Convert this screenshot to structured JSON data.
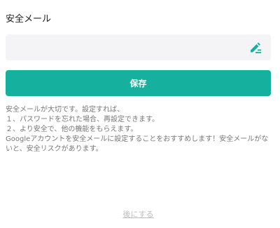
{
  "section": {
    "title": "安全メール"
  },
  "email_field": {
    "value": "",
    "placeholder": "",
    "edit_icon": "pencil-edit-icon"
  },
  "save_button": {
    "label": "保存"
  },
  "description": {
    "lines": [
      "安全メールが大切です。設定すれば、",
      "１、パスワードを忘れた場合、再設定できます。",
      "２、より安全で、他の機能をもらえます。",
      "Googleアカウントを安全メールに設定することをおすすめします！安全メールがないと、安全リスクがあります。"
    ]
  },
  "later_link": {
    "label": "後にする"
  },
  "colors": {
    "accent": "#16b09e",
    "field_bg": "#f4f4f7",
    "description_text": "#777777",
    "link_text": "#bdbdbd"
  }
}
